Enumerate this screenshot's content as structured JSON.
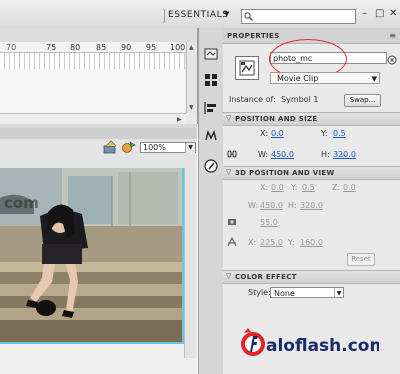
{
  "header": {
    "workspace_label": "ESSENTIALS",
    "workspace_arrow": "▼",
    "search_placeholder": "",
    "window_controls": [
      "–",
      "□",
      "✕"
    ]
  },
  "timeline": {
    "ruler_ticks": [
      "75",
      "80",
      "85",
      "90",
      "95",
      "100",
      "1"
    ],
    "partial_tick": "70"
  },
  "stage": {
    "zoom_value": "100%",
    "zoom_arrow": "▼",
    "watermark_text": "com"
  },
  "properties": {
    "tab_label": "PROPERTIES",
    "tab_menu": "≡",
    "instance_name": "photo_mc",
    "symbol_type": "Movie Clip",
    "symbol_type_arrow": "▼",
    "instance_of_label": "Instance of:",
    "instance_of_value": "Symbol 1",
    "swap_label": "Swap...",
    "position_size": {
      "title": "POSITION AND SIZE",
      "x_label": "X:",
      "x_value": "0.0",
      "y_label": "Y:",
      "y_value": "0.5",
      "w_label": "W:",
      "w_value": "450.0",
      "h_label": "H:",
      "h_value": "320.0"
    },
    "pos_3d": {
      "title": "3D POSITION AND VIEW",
      "x_label": "X:",
      "x_value": "0.0",
      "y_label": "Y:",
      "y_value": "0.5",
      "z_label": "Z:",
      "z_value": "0.0",
      "w_label": "W:",
      "w_value": "450.0",
      "h_label": "H:",
      "h_value": "320.0",
      "perspective_value": "55.0",
      "vx_label": "X:",
      "vx_value": "225.0",
      "vy_label": "Y:",
      "vy_value": "160.0",
      "reset_label": "Reset"
    },
    "color_effect": {
      "title": "COLOR EFFECT",
      "style_label": "Style:",
      "style_value": "None",
      "style_arrow": "▼"
    }
  },
  "branding": {
    "logo_text": "aloflash.com"
  },
  "colors": {
    "link_blue": "#1b57c9",
    "highlight_red": "#e0282e",
    "stage_border_cyan": "#68c6e8"
  }
}
